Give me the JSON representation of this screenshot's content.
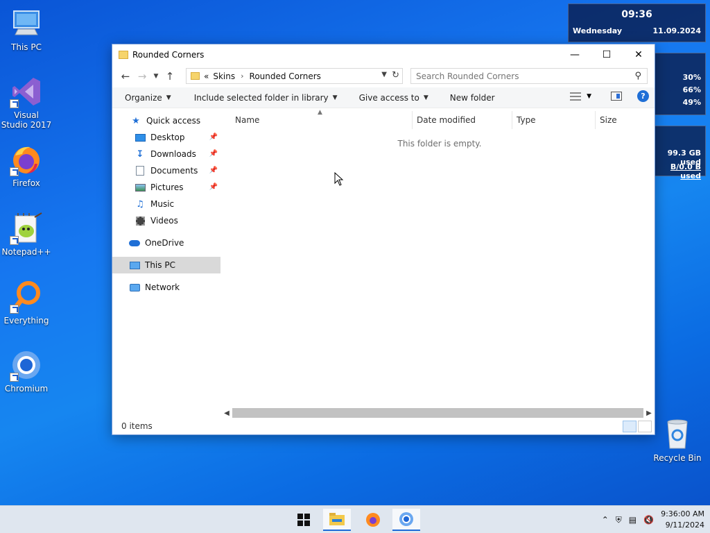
{
  "desktop": {
    "icons": [
      {
        "label": "This PC",
        "icon": "monitor-icon"
      },
      {
        "label": "Visual Studio 2017",
        "icon": "visual-studio-icon"
      },
      {
        "label": "Firefox",
        "icon": "firefox-icon"
      },
      {
        "label": "Notepad++",
        "icon": "notepadpp-icon"
      },
      {
        "label": "Everything",
        "icon": "everything-search-icon"
      },
      {
        "label": "Chromium",
        "icon": "chromium-icon"
      }
    ],
    "recycle_bin": {
      "label": "Recycle Bin",
      "icon": "recycle-bin-icon"
    }
  },
  "widgets": {
    "clock": {
      "time": "09:36",
      "day": "Wednesday",
      "date": "11.09.2024"
    },
    "stats": [
      "30%",
      "66%",
      "49%"
    ],
    "disk": [
      "99.3 GB used",
      "B/0.0 B used"
    ]
  },
  "explorer": {
    "title": "Rounded Corners",
    "breadcrumb": {
      "overflow": "«",
      "parent": "Skins",
      "current": "Rounded Corners"
    },
    "search": {
      "placeholder": "Search Rounded Corners"
    },
    "toolbar": {
      "organize": "Organize",
      "include_library": "Include selected folder in library",
      "give_access": "Give access to",
      "new_folder": "New folder"
    },
    "nav": {
      "quick_access": "Quick access",
      "quick_items": [
        {
          "label": "Desktop",
          "icon": "desktop-folder-icon",
          "pinned": true
        },
        {
          "label": "Downloads",
          "icon": "downloads-arrow-icon",
          "pinned": true
        },
        {
          "label": "Documents",
          "icon": "documents-icon",
          "pinned": true
        },
        {
          "label": "Pictures",
          "icon": "pictures-icon",
          "pinned": true
        },
        {
          "label": "Music",
          "icon": "music-note-icon",
          "pinned": false
        },
        {
          "label": "Videos",
          "icon": "videos-icon",
          "pinned": false
        }
      ],
      "onedrive": "OneDrive",
      "this_pc": "This PC",
      "network": "Network"
    },
    "columns": [
      "Name",
      "Date modified",
      "Type",
      "Size"
    ],
    "empty_message": "This folder is empty.",
    "status": "0 items"
  },
  "taskbar": {
    "apps": [
      "windows-start-icon",
      "file-explorer-icon",
      "firefox-icon",
      "chromium-icon"
    ],
    "clock": {
      "time": "9:36:00 AM",
      "date": "9/11/2024"
    },
    "colors": {
      "accent": "#1c6ad9",
      "taskbar_bg": "#dfe6ef"
    }
  }
}
